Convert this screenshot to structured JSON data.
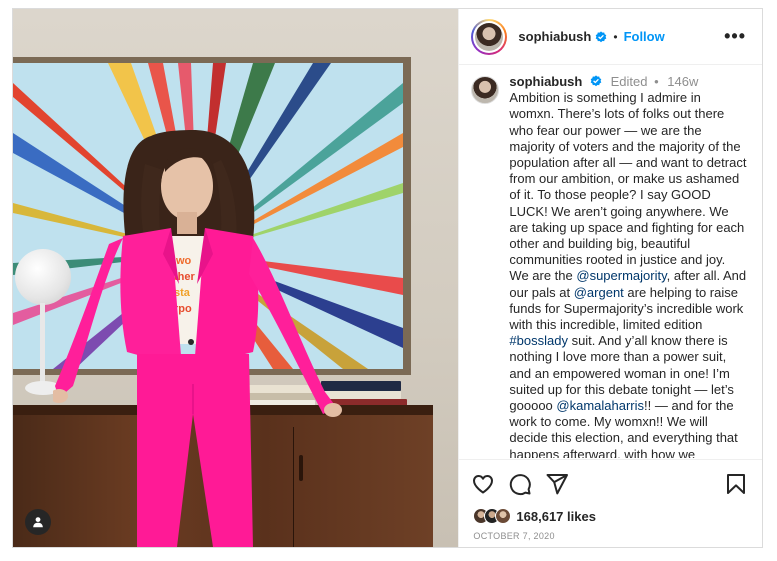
{
  "header": {
    "username": "sophiabush",
    "separator": "•",
    "follow_label": "Follow",
    "more_label": "•••"
  },
  "caption": {
    "username": "sophiabush",
    "edited": "Edited",
    "dot": "•",
    "age": "146w",
    "segments": [
      "Ambition is something I admire in womxn. There’s lots of folks out there who fear our power — we are the majority of voters and the majority of the population after all — and want to detract from our ambition, or make us ashamed of it. To those people? I say GOOD LUCK! We aren’t going anywhere. We are taking up space and fighting for each other and building big, beautiful communities rooted in justice and joy. We are the ",
      "@supermajority",
      ", after all. And our pals at ",
      "@argent",
      " are helping to raise funds for Supermajority’s incredible work with this incredible, limited edition ",
      "#bosslady",
      " suit. And y’all know there is nothing I love more than a power suit, and an empowered woman in one! I’m suited up for this debate tonight — let’s gooooo ",
      "@kamalaharris",
      "!! — and for the work to come. My womxn!! We will decide this election, and everything that happens afterward, with how we"
    ]
  },
  "engagement": {
    "likes": "168,617 likes",
    "date": "OCTOBER 7, 2020"
  },
  "colors": {
    "accent": "#0095f6",
    "mention": "#00376b",
    "suit": "#ff1f9a",
    "verified": "#0095f6"
  },
  "icons": [
    "heart-icon",
    "comment-icon",
    "share-icon",
    "bookmark-icon",
    "more-icon",
    "verified-badge-icon",
    "user-tag-icon"
  ]
}
